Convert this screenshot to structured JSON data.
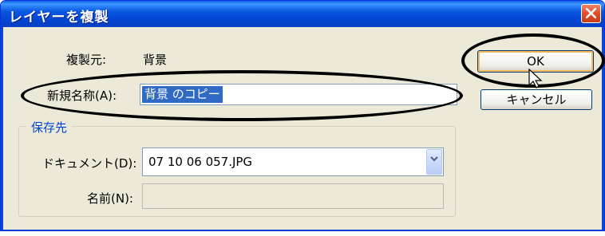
{
  "window": {
    "title": "レイヤーを複製",
    "close_icon": "close-icon"
  },
  "form": {
    "duplicate_label": "複製元:",
    "duplicate_value": "背景",
    "as_label": "新規名称(A):",
    "as_value": "背景 のコピー"
  },
  "destination": {
    "group_label": "保存先",
    "document_label": "ドキュメント(D):",
    "document_value": "07 10 06 057.JPG",
    "name_label": "名前(N):",
    "name_value": ""
  },
  "buttons": {
    "ok_label": "OK",
    "cancel_label": "キャンセル"
  },
  "colors": {
    "title_bar": "#0a58e0",
    "dialog_bg": "#ece9d8",
    "selection": "#316ac5",
    "group_label": "#0046d5",
    "close_button": "#e2522d"
  },
  "icons": [
    "close-icon",
    "chevron-down-icon",
    "mouse-pointer-icon"
  ]
}
